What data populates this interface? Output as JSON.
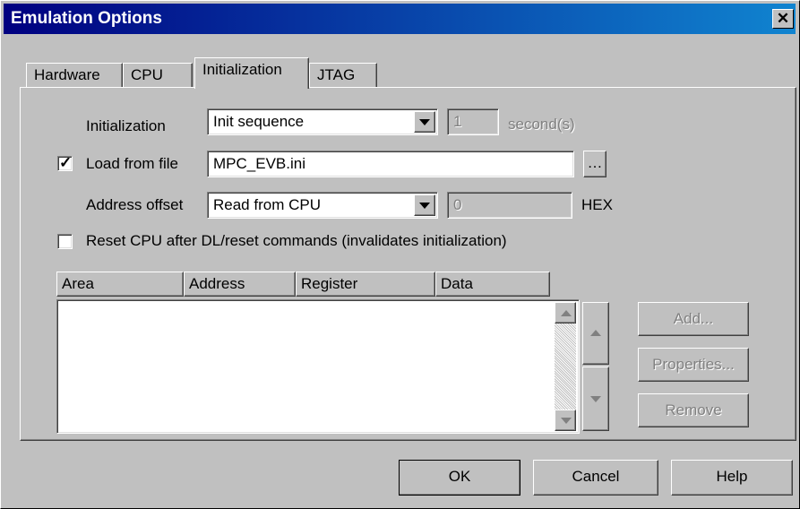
{
  "window": {
    "title": "Emulation Options"
  },
  "tabs": [
    {
      "label": "Hardware"
    },
    {
      "label": "CPU"
    },
    {
      "label": "Initialization"
    },
    {
      "label": "JTAG"
    }
  ],
  "init_section": {
    "label": "Initialization",
    "selected": "Init sequence",
    "seconds_value": "1",
    "seconds_unit": "second(s)"
  },
  "load_file": {
    "checked": true,
    "label": "Load from file",
    "value": "MPC_EVB.ini",
    "browse": "…"
  },
  "address_offset": {
    "label": "Address offset",
    "selected": "Read from CPU",
    "value": "0",
    "unit": "HEX"
  },
  "reset_cpu": {
    "checked": false,
    "label": "Reset CPU after DL/reset commands (invalidates initialization)"
  },
  "table": {
    "columns": [
      "Area",
      "Address",
      "Register",
      "Data"
    ],
    "rows": []
  },
  "side_buttons": {
    "add": "Add...",
    "properties": "Properties...",
    "remove": "Remove"
  },
  "footer": {
    "ok": "OK",
    "cancel": "Cancel",
    "help": "Help"
  }
}
